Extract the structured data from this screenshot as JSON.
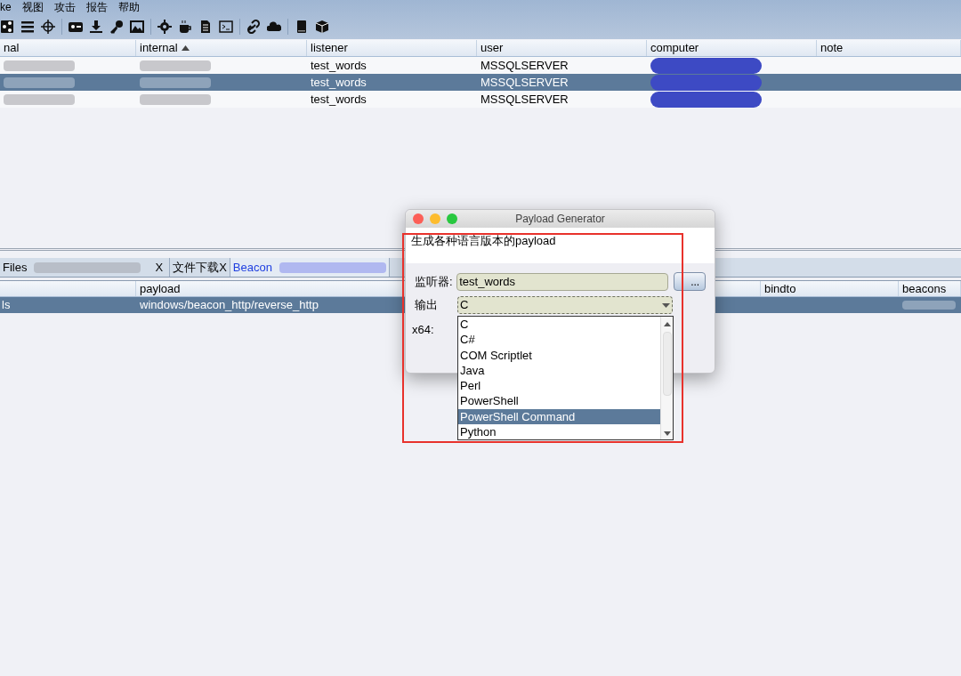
{
  "menu": [
    "ke",
    "视图",
    "攻击",
    "报告",
    "帮助"
  ],
  "sessions": {
    "columns": [
      {
        "label": "nal",
        "sorted": false
      },
      {
        "label": "internal",
        "sorted": true
      },
      {
        "label": "listener",
        "sorted": false
      },
      {
        "label": "user",
        "sorted": false
      },
      {
        "label": "computer",
        "sorted": false
      },
      {
        "label": "note",
        "sorted": false
      }
    ],
    "rows": [
      {
        "listener": "test_words",
        "user": "MSSQLSERVER",
        "selected": false
      },
      {
        "listener": "test_words",
        "user": "MSSQLSERVER",
        "selected": true
      },
      {
        "listener": "test_words",
        "user": "MSSQLSERVER",
        "selected": false
      }
    ]
  },
  "tabs": [
    {
      "label": "Files",
      "close": "X",
      "selected": false
    },
    {
      "label": "文件下载X",
      "selected": false
    },
    {
      "label": "Beacon",
      "selected": true
    }
  ],
  "listeners": {
    "columns": [
      "payload",
      "bindto",
      "beacons"
    ],
    "rows": [
      {
        "name": "ls",
        "payload": "windows/beacon_http/reverse_http",
        "selected": true
      }
    ]
  },
  "dialog": {
    "title": "Payload Generator",
    "description": "生成各种语言版本的payload",
    "listener_label": "监听器:",
    "listener_value": "test_words",
    "browse_button": "...",
    "output_label": "输出",
    "output_value": "C",
    "x64_label": "x64:",
    "options": [
      {
        "label": "C",
        "selected": false
      },
      {
        "label": "C#",
        "selected": false
      },
      {
        "label": "COM Scriptlet",
        "selected": false
      },
      {
        "label": "Java",
        "selected": false
      },
      {
        "label": "Perl",
        "selected": false
      },
      {
        "label": "PowerShell",
        "selected": false
      },
      {
        "label": "PowerShell Command",
        "selected": true
      },
      {
        "label": "Python",
        "selected": false
      }
    ]
  }
}
